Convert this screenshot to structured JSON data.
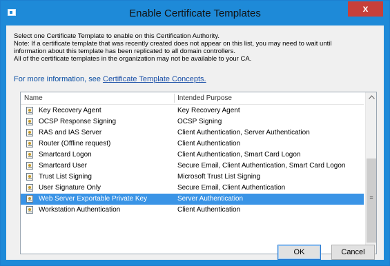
{
  "window": {
    "title": "Enable Certificate Templates",
    "close_glyph": "x"
  },
  "description": {
    "lines": [
      "Select one Certificate Template to enable on this Certification Authority.",
      "Note: If a certificate template that was recently created does not appear on this list, you may need to wait until",
      "information about this template has been replicated to all domain controllers.",
      "All of the certificate templates in the organization may not be available to your CA."
    ],
    "more_prefix": "For more information, see ",
    "more_link": "Certificate Template Concepts."
  },
  "list": {
    "columns": [
      "Name",
      "Intended Purpose"
    ],
    "rows": [
      {
        "name": "Key Recovery Agent",
        "purpose": "Key Recovery Agent",
        "selected": false
      },
      {
        "name": "OCSP Response Signing",
        "purpose": "OCSP Signing",
        "selected": false
      },
      {
        "name": "RAS and IAS Server",
        "purpose": "Client Authentication, Server Authentication",
        "selected": false
      },
      {
        "name": "Router (Offline request)",
        "purpose": "Client Authentication",
        "selected": false
      },
      {
        "name": "Smartcard Logon",
        "purpose": "Client Authentication, Smart Card Logon",
        "selected": false
      },
      {
        "name": "Smartcard User",
        "purpose": "Secure Email, Client Authentication, Smart Card Logon",
        "selected": false
      },
      {
        "name": "Trust List Signing",
        "purpose": "Microsoft Trust List Signing",
        "selected": false
      },
      {
        "name": "User Signature Only",
        "purpose": "Secure Email, Client Authentication",
        "selected": false
      },
      {
        "name": "Web Server Exportable Private Key",
        "purpose": "Server Authentication",
        "selected": true
      },
      {
        "name": "Workstation Authentication",
        "purpose": "Client Authentication",
        "selected": false
      }
    ],
    "row_icon": "certificate-template-icon"
  },
  "scrollbar": {
    "up_glyph": "^",
    "down_glyph": "v",
    "grip_glyph": "≡"
  },
  "buttons": {
    "ok": "OK",
    "cancel": "Cancel"
  },
  "colors": {
    "titlebar": "#1e8ad8",
    "close": "#c7403a",
    "selection": "#3a94e6"
  }
}
